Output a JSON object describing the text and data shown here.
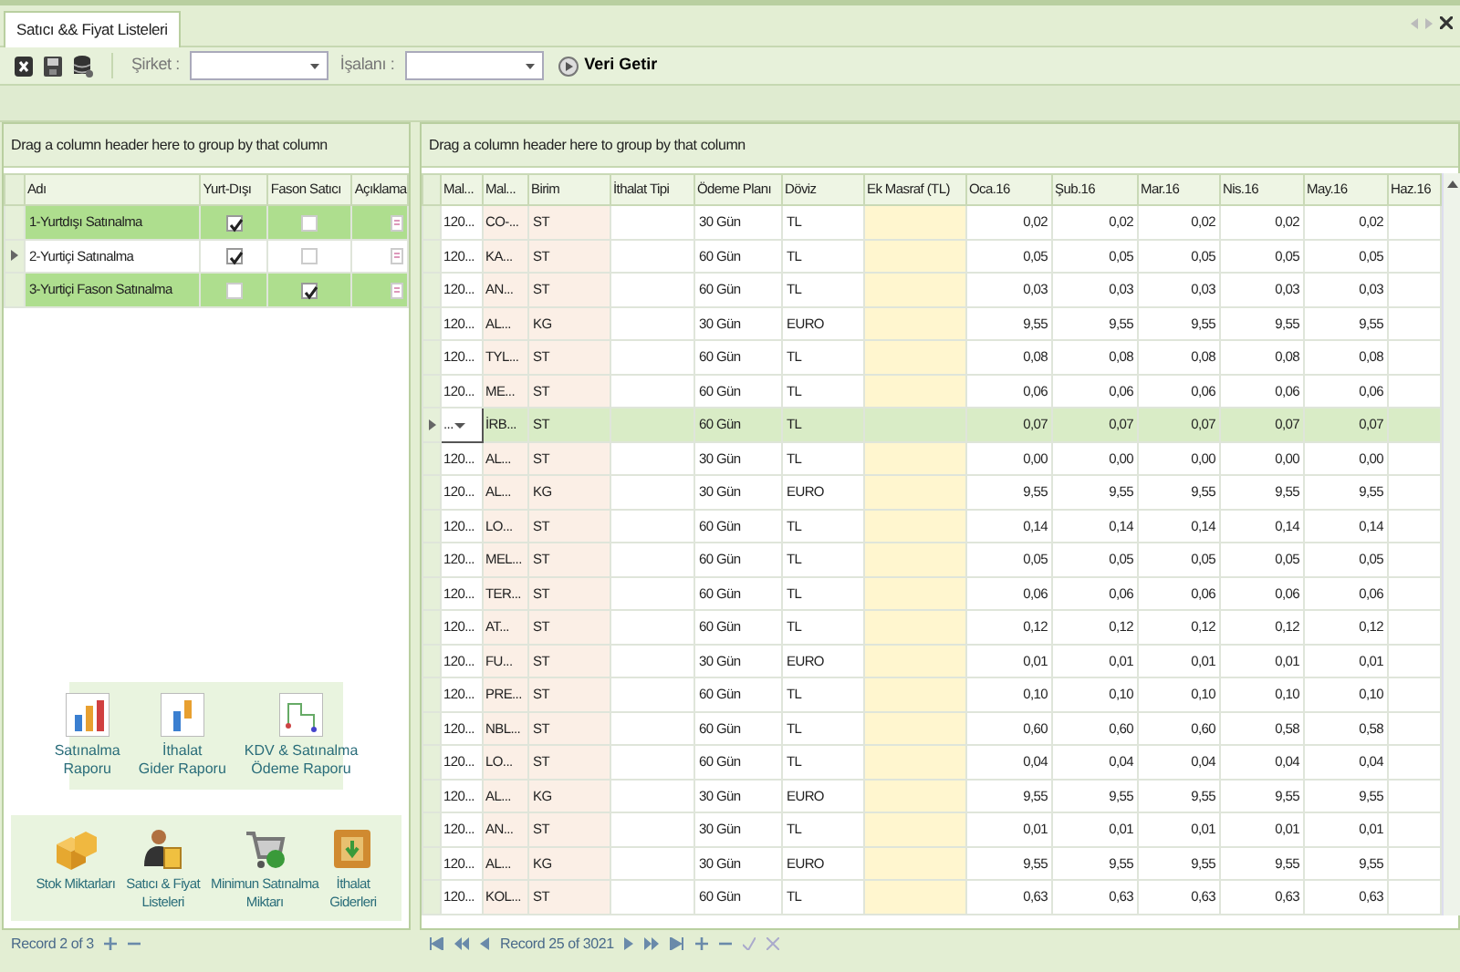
{
  "tab": {
    "label": "Satıcı && Fiyat Listeleri",
    "selected": true
  },
  "toolbar": {
    "fields": [
      {
        "label": "Şirket :"
      },
      {
        "label": "İşalanı :"
      }
    ],
    "action": "Veri Getir"
  },
  "left_grid": {
    "group_hint": "Drag a column header here to group by that column",
    "columns": [
      "Adı",
      "Yurt-Dışı",
      "Fason Satıcı",
      "Açıklama"
    ],
    "rows": [
      {
        "name": "1-Yurtdışı Satınalma",
        "yurt_disi": true,
        "fason": false,
        "selected": true,
        "current": false
      },
      {
        "name": "2-Yurtiçi Satınalma",
        "yurt_disi": true,
        "fason": false,
        "selected": false,
        "current": true
      },
      {
        "name": "3-Yurtiçi Fason Satınalma",
        "yurt_disi": false,
        "fason": true,
        "selected": true,
        "current": false
      }
    ],
    "record": "Record 2 of 3"
  },
  "reports": [
    {
      "items": [
        {
          "kind": "bars",
          "lines": [
            "Satınalma",
            "Raporu"
          ]
        },
        {
          "kind": "bars2",
          "lines": [
            "İthalat",
            "Gider Raporu"
          ]
        },
        {
          "kind": "flow",
          "lines": [
            "KDV & Satınalma",
            "Ödeme Raporu"
          ]
        }
      ]
    },
    {
      "items": [
        {
          "kind": "boxes",
          "lines": [
            "Stok Miktarları"
          ]
        },
        {
          "kind": "person",
          "lines": [
            "Satıcı & Fiyat",
            "Listeleri"
          ]
        },
        {
          "kind": "cart",
          "lines": [
            "Minimun Satınalma",
            "Miktarı"
          ]
        },
        {
          "kind": "crate",
          "lines": [
            "İthalat",
            "Giderleri"
          ]
        }
      ]
    }
  ],
  "right_grid": {
    "group_hint": "Drag a column header here to group by that column",
    "columns": [
      "Mal...",
      "Mal...",
      "Birim",
      "İthalat Tipi",
      "Ödeme Planı",
      "Döviz",
      "Ek Masraf (TL)",
      "Oca.16",
      "Şub.16",
      "Mar.16",
      "Nis.16",
      "May.16",
      "Haz.16"
    ],
    "rows": [
      {
        "selected": false,
        "cells": [
          "120...",
          "CO-...",
          "ST",
          "",
          "30 Gün",
          "TL",
          "",
          "0,02",
          "0,02",
          "0,02",
          "0,02",
          "0,02",
          ""
        ]
      },
      {
        "selected": false,
        "cells": [
          "120...",
          "KA...",
          "ST",
          "",
          "60 Gün",
          "TL",
          "",
          "0,05",
          "0,05",
          "0,05",
          "0,05",
          "0,05",
          ""
        ]
      },
      {
        "selected": false,
        "cells": [
          "120...",
          "AN...",
          "ST",
          "",
          "60 Gün",
          "TL",
          "",
          "0,03",
          "0,03",
          "0,03",
          "0,03",
          "0,03",
          ""
        ]
      },
      {
        "selected": false,
        "cells": [
          "120...",
          "AL...",
          "KG",
          "",
          "30 Gün",
          "EURO",
          "",
          "9,55",
          "9,55",
          "9,55",
          "9,55",
          "9,55",
          ""
        ]
      },
      {
        "selected": false,
        "cells": [
          "120...",
          "TYL...",
          "ST",
          "",
          "60 Gün",
          "TL",
          "",
          "0,08",
          "0,08",
          "0,08",
          "0,08",
          "0,08",
          ""
        ]
      },
      {
        "selected": false,
        "cells": [
          "120...",
          "ME...",
          "ST",
          "",
          "60 Gün",
          "TL",
          "",
          "0,06",
          "0,06",
          "0,06",
          "0,06",
          "0,06",
          ""
        ]
      },
      {
        "selected": true,
        "cells": [
          "...",
          "İRB...",
          "ST",
          "",
          "60 Gün",
          "TL",
          "",
          "0,07",
          "0,07",
          "0,07",
          "0,07",
          "0,07",
          ""
        ]
      },
      {
        "selected": false,
        "cells": [
          "120...",
          "AL...",
          "ST",
          "",
          "30 Gün",
          "TL",
          "",
          "0,00",
          "0,00",
          "0,00",
          "0,00",
          "0,00",
          ""
        ]
      },
      {
        "selected": false,
        "cells": [
          "120...",
          "AL...",
          "KG",
          "",
          "30 Gün",
          "EURO",
          "",
          "9,55",
          "9,55",
          "9,55",
          "9,55",
          "9,55",
          ""
        ]
      },
      {
        "selected": false,
        "cells": [
          "120...",
          "LO...",
          "ST",
          "",
          "60 Gün",
          "TL",
          "",
          "0,14",
          "0,14",
          "0,14",
          "0,14",
          "0,14",
          ""
        ]
      },
      {
        "selected": false,
        "cells": [
          "120...",
          "MEL...",
          "ST",
          "",
          "60 Gün",
          "TL",
          "",
          "0,05",
          "0,05",
          "0,05",
          "0,05",
          "0,05",
          ""
        ]
      },
      {
        "selected": false,
        "cells": [
          "120...",
          "TER...",
          "ST",
          "",
          "60 Gün",
          "TL",
          "",
          "0,06",
          "0,06",
          "0,06",
          "0,06",
          "0,06",
          ""
        ]
      },
      {
        "selected": false,
        "cells": [
          "120...",
          "AT...",
          "ST",
          "",
          "60 Gün",
          "TL",
          "",
          "0,12",
          "0,12",
          "0,12",
          "0,12",
          "0,12",
          ""
        ]
      },
      {
        "selected": false,
        "cells": [
          "120...",
          "FU...",
          "ST",
          "",
          "30 Gün",
          "EURO",
          "",
          "0,01",
          "0,01",
          "0,01",
          "0,01",
          "0,01",
          ""
        ]
      },
      {
        "selected": false,
        "cells": [
          "120...",
          "PRE...",
          "ST",
          "",
          "60 Gün",
          "TL",
          "",
          "0,10",
          "0,10",
          "0,10",
          "0,10",
          "0,10",
          ""
        ]
      },
      {
        "selected": false,
        "cells": [
          "120...",
          "NBL...",
          "ST",
          "",
          "60 Gün",
          "TL",
          "",
          "0,60",
          "0,60",
          "0,60",
          "0,58",
          "0,58",
          ""
        ]
      },
      {
        "selected": false,
        "cells": [
          "120...",
          "LO...",
          "ST",
          "",
          "60 Gün",
          "TL",
          "",
          "0,04",
          "0,04",
          "0,04",
          "0,04",
          "0,04",
          ""
        ]
      },
      {
        "selected": false,
        "cells": [
          "120...",
          "AL...",
          "KG",
          "",
          "30 Gün",
          "EURO",
          "",
          "9,55",
          "9,55",
          "9,55",
          "9,55",
          "9,55",
          ""
        ]
      },
      {
        "selected": false,
        "cells": [
          "120...",
          "AN...",
          "ST",
          "",
          "30 Gün",
          "TL",
          "",
          "0,01",
          "0,01",
          "0,01",
          "0,01",
          "0,01",
          ""
        ]
      },
      {
        "selected": false,
        "cells": [
          "120...",
          "AL...",
          "KG",
          "",
          "30 Gün",
          "EURO",
          "",
          "9,55",
          "9,55",
          "9,55",
          "9,55",
          "9,55",
          ""
        ]
      },
      {
        "selected": false,
        "cells": [
          "120...",
          "KOL...",
          "ST",
          "",
          "60 Gün",
          "TL",
          "",
          "0,63",
          "0,63",
          "0,63",
          "0,63",
          "0,63",
          ""
        ]
      }
    ],
    "record": "Record 25 of 3021"
  }
}
